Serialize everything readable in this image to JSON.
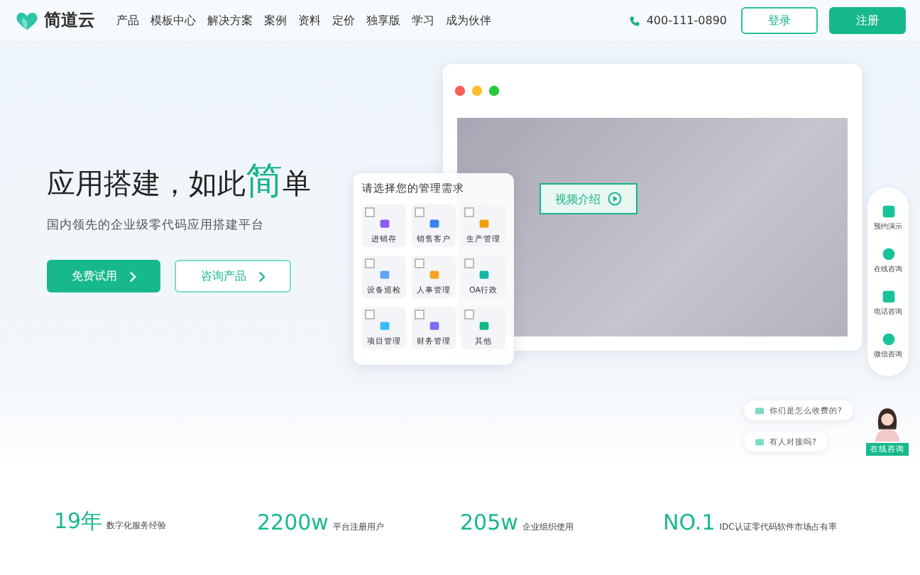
{
  "header": {
    "logo": "简道云",
    "nav": [
      "产品",
      "模板中心",
      "解决方案",
      "案例",
      "资料",
      "定价",
      "独享版",
      "学习",
      "成为伙伴"
    ],
    "phone": "400-111-0890",
    "login": "登录",
    "register": "注册"
  },
  "hero": {
    "title": "应用搭建，如此",
    "highlight": "简",
    "title_end": "单",
    "subtitle": "国内领先的企业级零代码应用搭建平台",
    "primary": "免费试用",
    "secondary": "咨询产品"
  },
  "mockup": {
    "video_button": "视频介绍"
  },
  "picker": {
    "title": "请选择您的管理需求",
    "options": [
      {
        "label": "进销存",
        "checked": false,
        "color": "#8b5cf6"
      },
      {
        "label": "销售客户",
        "checked": false,
        "color": "#3b82f6"
      },
      {
        "label": "生产管理",
        "checked": false,
        "color": "#f59e0b"
      },
      {
        "label": "设备巡检",
        "checked": false,
        "color": "#60a5fa"
      },
      {
        "label": "人事管理",
        "checked": false,
        "color": "#f5a524"
      },
      {
        "label": "OA行政",
        "checked": false,
        "color": "#14b8a6"
      },
      {
        "label": "项目管理",
        "checked": false,
        "color": "#38bdf8"
      },
      {
        "label": "财务管理",
        "checked": false,
        "color": "#7c6cf0"
      },
      {
        "label": "其他",
        "checked": false,
        "color": "#10b981"
      }
    ]
  },
  "side_rail": [
    "预约演示",
    "在线咨询",
    "电话咨询",
    "微信咨询"
  ],
  "chat": {
    "questions": [
      "你们是怎么收费的?",
      "有人对接吗?"
    ],
    "agent_label": "在线咨询"
  },
  "stats": [
    {
      "value": "19年",
      "label": "数字化服务经验"
    },
    {
      "value": "2200w",
      "label": "平台注册用户"
    },
    {
      "value": "205w",
      "label": "企业组织使用"
    },
    {
      "value": "NO.1",
      "label": "IDC认证零代码软件市场占有率"
    }
  ]
}
